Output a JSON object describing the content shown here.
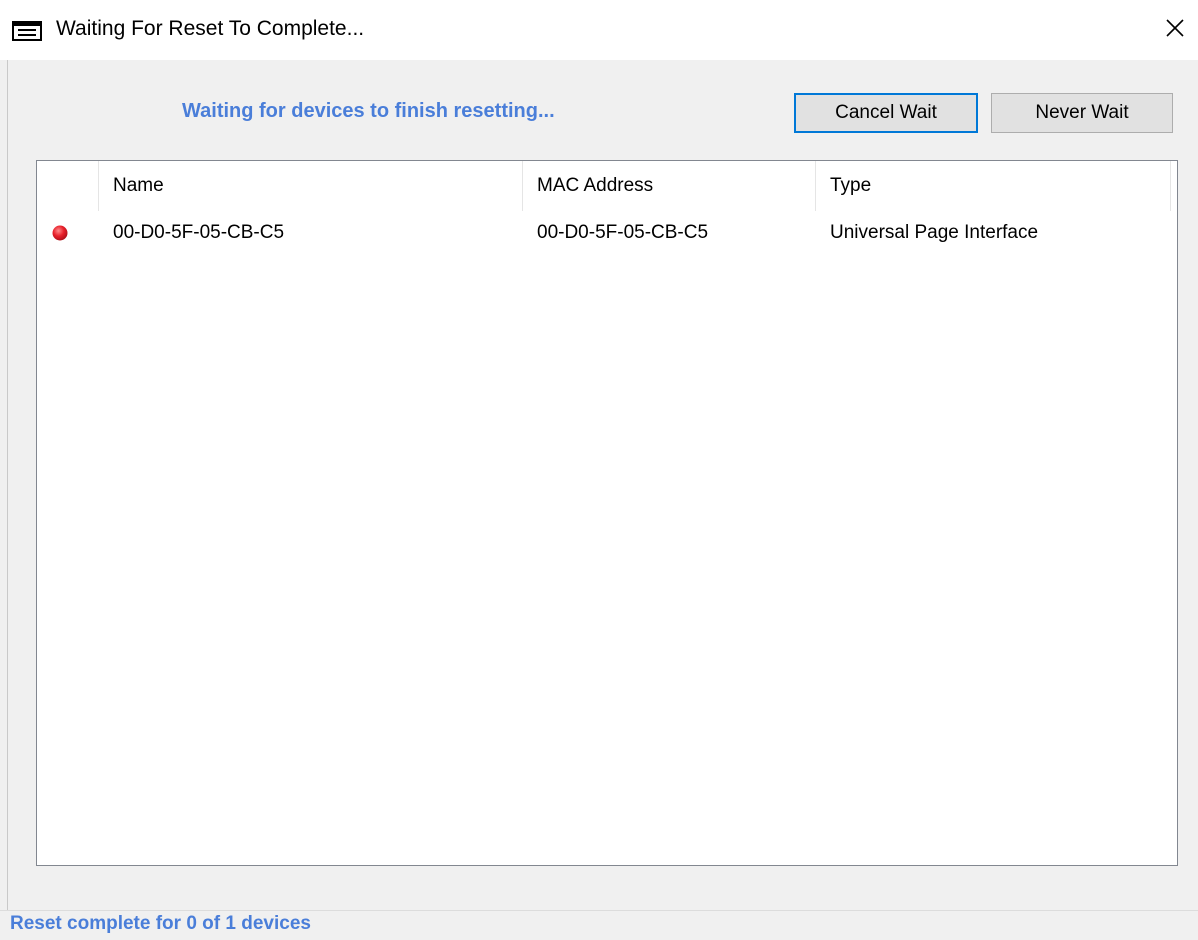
{
  "window": {
    "title": "Waiting For Reset To Complete...",
    "close_glyph": "✕"
  },
  "main": {
    "message": "Waiting for devices to finish resetting...",
    "cancel_label": "Cancel Wait",
    "never_label": "Never Wait"
  },
  "list": {
    "columns": [
      "Name",
      "MAC Address",
      "Type"
    ],
    "rows": [
      {
        "status": "not-reset",
        "name": "00-D0-5F-05-CB-C5",
        "mac": "00-D0-5F-05-CB-C5",
        "type": "Universal Page Interface"
      }
    ]
  },
  "statusbar": {
    "text": "Reset complete for 0 of 1 devices"
  },
  "colors": {
    "accent": "#4a7ed9",
    "focus_border": "#0078d7",
    "status_dot": "#e8202a"
  },
  "icons": {
    "window_icon": "application-window-icon",
    "status": "red-status-dot-icon",
    "close": "close-icon"
  }
}
